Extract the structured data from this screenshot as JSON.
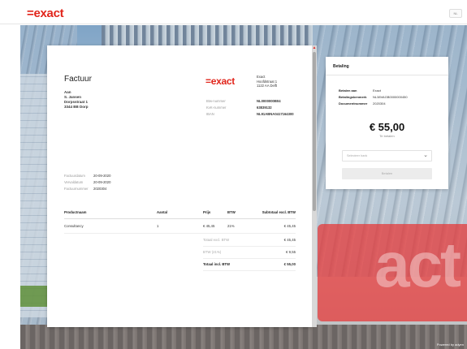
{
  "header": {
    "logo": "=exact",
    "language_button": "NL"
  },
  "background": {
    "sign_text": "act",
    "powered_by": "Powered by adyen"
  },
  "invoice": {
    "title": "Factuur",
    "logo": "=exact",
    "recipient": [
      "Aan",
      "S. Jansen",
      "Dorpsstraat 1",
      "3344 BB Dorp"
    ],
    "company": [
      "Exact",
      "Hoofdstraat 1",
      "1122 AA Delft"
    ],
    "registration": [
      {
        "label": "Btw-nummer",
        "value": "NL0000000B04"
      },
      {
        "label": "KvK-nummer",
        "value": "63839132"
      },
      {
        "label": "IBAN",
        "value": "NL91ABNA0417164300"
      }
    ],
    "dates": [
      {
        "label": "Factuurdatum",
        "value": "20-09-2020"
      },
      {
        "label": "Vervaldatum",
        "value": "20-09-2020"
      },
      {
        "label": "Factuurnummer",
        "value": "2020304"
      }
    ],
    "items": {
      "headers": [
        "Productnaam",
        "Aantal",
        "Prijs",
        "BTW",
        "Subtotaal excl. BTW"
      ],
      "rows": [
        [
          "Consultancy",
          "1",
          "€ 45,45",
          "21%",
          "€ 45,45"
        ]
      ]
    },
    "totals": [
      {
        "label": "Totaal excl. BTW",
        "value": "€ 45,45"
      },
      {
        "label": "BTW (21%)",
        "value": "€ 9,55"
      },
      {
        "label": "Totaal incl. BTW",
        "value": "€ 55,00"
      }
    ]
  },
  "payment": {
    "title": "Betaling",
    "fields": [
      {
        "label": "Betalen aan",
        "value": "Exact"
      },
      {
        "label": "Betalingskenmerk",
        "value": "NL38VAGB0000000450"
      },
      {
        "label": "Documentnummer",
        "value": "2020304"
      }
    ],
    "amount": "€ 55,00",
    "amount_sub": "Te betalen",
    "bank_placeholder": "Selecteer bank",
    "pay_button": "Betalen"
  }
}
